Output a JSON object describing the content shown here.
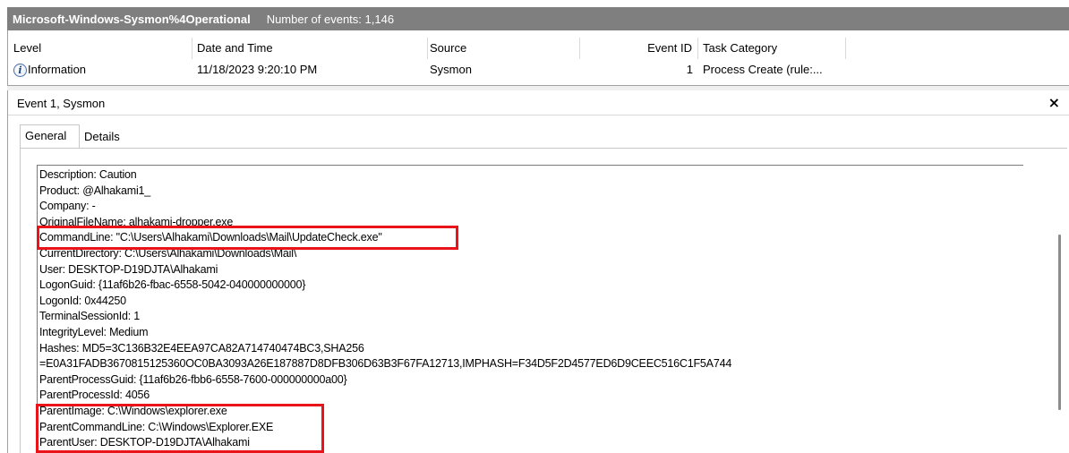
{
  "titlebar": {
    "log_name": "Microsoft-Windows-Sysmon%4Operational",
    "event_count": "Number of events: 1,146"
  },
  "event_list": {
    "columns": [
      "Level",
      "Date and Time",
      "Source",
      "Event ID",
      "Task Category"
    ],
    "rows": [
      {
        "level": "Information",
        "level_icon": "info-icon",
        "date_time": "11/18/2023 9:20:10 PM",
        "source": "Sysmon",
        "event_id": "1",
        "task_category": "Process Create (rule:..."
      }
    ]
  },
  "detail": {
    "title": "Event 1, Sysmon",
    "close_symbol": "×",
    "tabs": [
      "General",
      "Details"
    ],
    "active_tab": "General",
    "lines": [
      "Description: Caution",
      "Product: @Alhakami1_",
      "Company: -",
      "OriginalFileName: alhakami-dropper.exe",
      "CommandLine: \"C:\\Users\\Alhakami\\Downloads\\Mail\\UpdateCheck.exe\"",
      "CurrentDirectory: C:\\Users\\Alhakami\\Downloads\\Mail\\",
      "User: DESKTOP-D19DJTA\\Alhakami",
      "LogonGuid: {11af6b26-fbac-6558-5042-040000000000}",
      "LogonId: 0x44250",
      "TerminalSessionId: 1",
      "IntegrityLevel: Medium",
      "Hashes: MD5=3C136B32E4EEA97CA82A714740474BC3,SHA256",
      "=E0A31FADB3670815125360OC0BA3093A26E187887D8DFB306D63B3F67FA12713,IMPHASH=F34D5F2D4577ED6D9CEEC516C1F5A744",
      "ParentProcessGuid: {11af6b26-fbb6-6558-7600-000000000a00}",
      "ParentProcessId: 4056",
      "ParentImage: C:\\Windows\\explorer.exe",
      "ParentCommandLine: C:\\Windows\\Explorer.EXE",
      "ParentUser: DESKTOP-D19DJTA\\Alhakami"
    ]
  },
  "colors": {
    "titlebar_bg": "#7f7f7f",
    "highlight": "#e8141a"
  }
}
